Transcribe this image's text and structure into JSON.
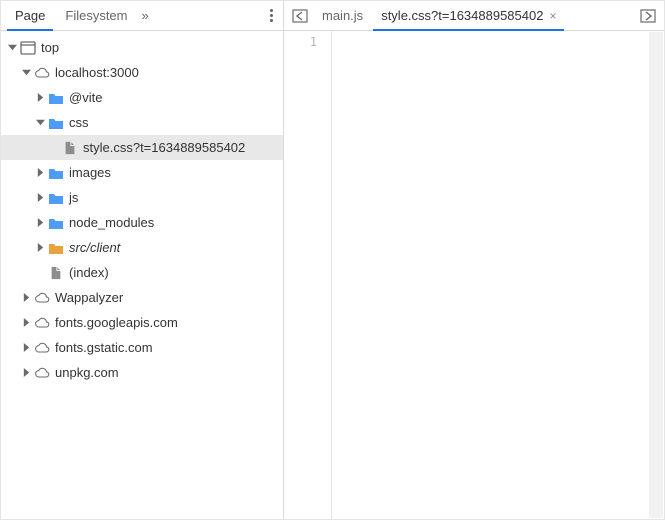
{
  "sidebar": {
    "tabs": {
      "page": "Page",
      "filesystem": "Filesystem"
    },
    "tree": {
      "top": "top",
      "localhost": "localhost:3000",
      "vite": "@vite",
      "css": "css",
      "stylefile": "style.css?t=1634889585402",
      "images": "images",
      "js": "js",
      "node_modules": "node_modules",
      "srcclient": "src/client",
      "index": "(index)",
      "wappalyzer": "Wappalyzer",
      "fontsgoogle": "fonts.googleapis.com",
      "fontsgstatic": "fonts.gstatic.com",
      "unpkg": "unpkg.com"
    }
  },
  "editor": {
    "tabs": {
      "mainjs": "main.js",
      "stylecss": "style.css?t=1634889585402"
    },
    "gutter_line": "1"
  },
  "colors": {
    "accent": "#1a73e8",
    "folder": "#4d9df6",
    "folder_alt": "#e8a33d"
  }
}
